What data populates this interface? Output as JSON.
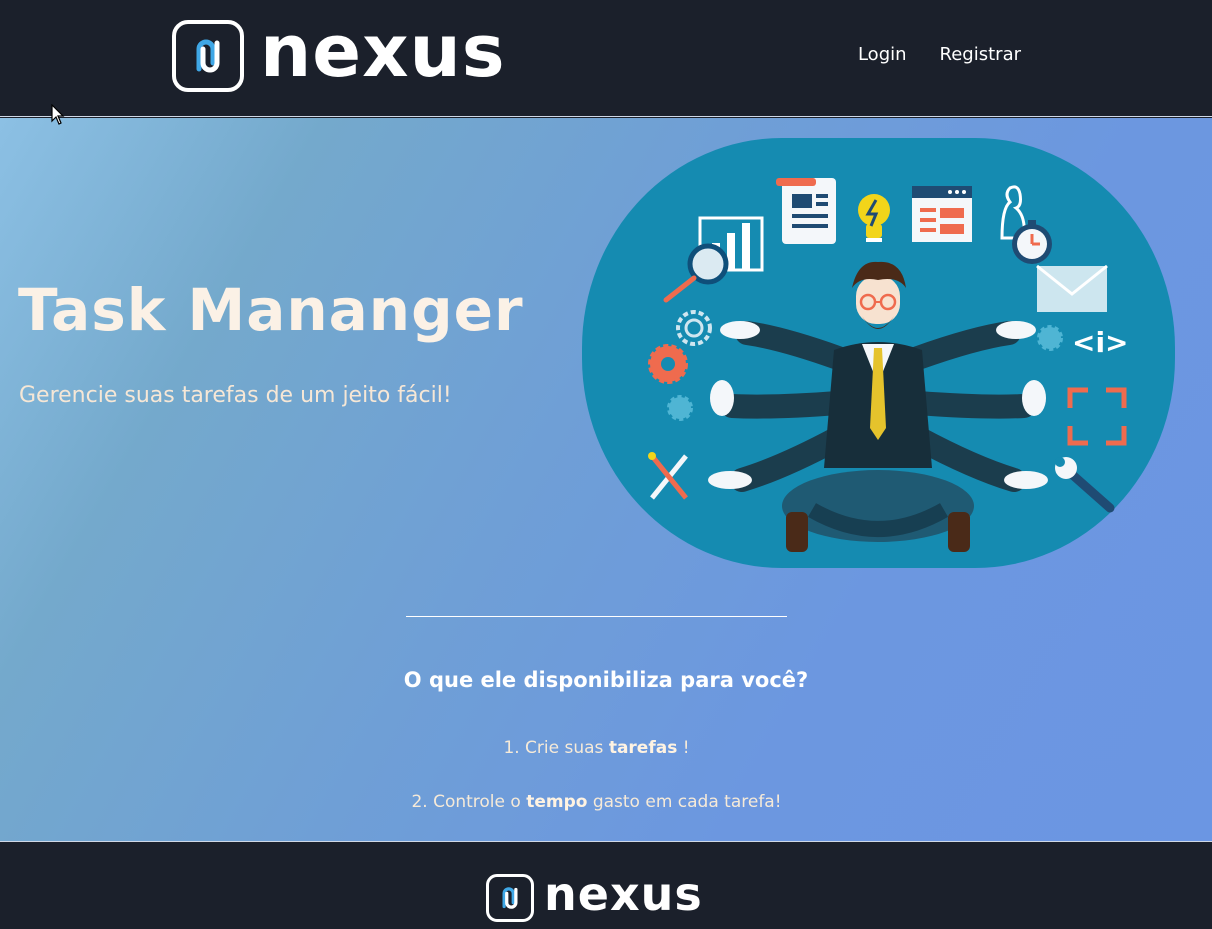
{
  "header": {
    "logo_text": "nexus",
    "nav": [
      {
        "label": "Login"
      },
      {
        "label": "Registrar"
      }
    ]
  },
  "hero": {
    "title": "Task Mananger",
    "subtitle": "Gerencie suas tarefas de um jeito fácil!"
  },
  "features": {
    "title": "O que ele disponibiliza para você?",
    "items": [
      {
        "prefix": "1. Crie suas ",
        "bold": "tarefas",
        "suffix": " !"
      },
      {
        "prefix": "2. Controle o ",
        "bold": "tempo",
        "suffix": " gasto em cada tarefa!"
      }
    ]
  },
  "footer": {
    "logo_text": "nexus"
  },
  "colors": {
    "header_bg": "#1b202b",
    "accent_blue": "#3fa7e6",
    "illustration_bg": "#158bb1"
  }
}
